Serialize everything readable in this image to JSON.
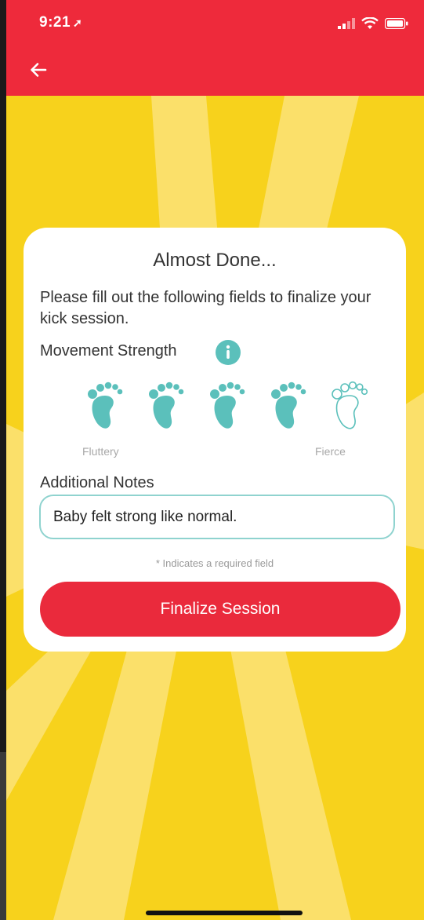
{
  "status_bar": {
    "time": "9:21",
    "location_arrow": "location-arrow-icon",
    "signal": "cellular-signal-icon",
    "wifi": "wifi-icon",
    "battery": "battery-icon"
  },
  "header": {
    "back_icon": "back-arrow-icon"
  },
  "card": {
    "title": "Almost Done...",
    "description": "Please fill out the following fields to finalize your kick session.",
    "movement_strength": {
      "label": "Movement Strength",
      "info_icon": "info-icon",
      "rating": 4,
      "max": 5,
      "min_label": "Fluttery",
      "max_label": "Fierce"
    },
    "notes": {
      "label": "Additional Notes",
      "value": "Baby felt strong like normal."
    },
    "required_note": "* Indicates a required field",
    "finalize_label": "Finalize Session"
  },
  "colors": {
    "header_red": "#ee2a3b",
    "background_yellow": "#f7d21c",
    "accent_teal": "#5bc0bb",
    "button_red": "#ea2a3c"
  }
}
